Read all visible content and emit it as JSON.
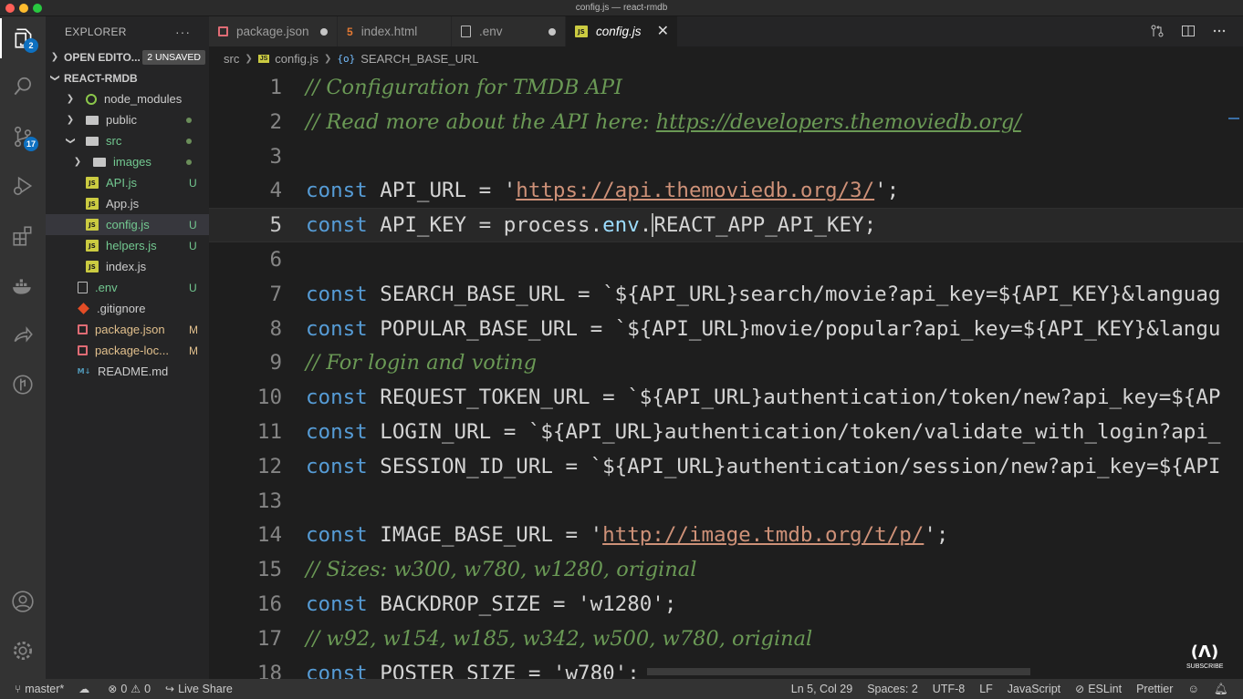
{
  "window": {
    "title": "config.js — react-rmdb"
  },
  "activity": {
    "explorer_badge": "2",
    "scm_badge": "17"
  },
  "sidebar": {
    "header": "EXPLORER",
    "more": "···",
    "open_editors": {
      "label": "OPEN EDITO...",
      "badge": "2 UNSAVED"
    },
    "project": "REACT-RMDB",
    "tree": [
      {
        "name": "node_modules",
        "status": ""
      },
      {
        "name": "public",
        "status": ""
      },
      {
        "name": "src",
        "status": ""
      },
      {
        "name": "images",
        "status": ""
      },
      {
        "name": "API.js",
        "status": "U"
      },
      {
        "name": "App.js",
        "status": ""
      },
      {
        "name": "config.js",
        "status": "U"
      },
      {
        "name": "helpers.js",
        "status": "U"
      },
      {
        "name": "index.js",
        "status": ""
      },
      {
        "name": ".env",
        "status": "U"
      },
      {
        "name": ".gitignore",
        "status": ""
      },
      {
        "name": "package.json",
        "status": "M"
      },
      {
        "name": "package-loc...",
        "status": "M"
      },
      {
        "name": "README.md",
        "status": ""
      }
    ]
  },
  "tabs": [
    {
      "label": "package.json",
      "icon": "json-icon"
    },
    {
      "label": "index.html",
      "icon": "html-icon"
    },
    {
      "label": ".env",
      "icon": "env-file-icon"
    },
    {
      "label": "config.js",
      "icon": "js-icon"
    }
  ],
  "breadcrumb": {
    "folder": "src",
    "file": "config.js",
    "symbol": "SEARCH_BASE_URL",
    "js_badge": "JS",
    "symbol_icon": "{o}"
  },
  "editor": {
    "lines": [
      [
        [
          "com",
          "// Configuration for TMDB API"
        ]
      ],
      [
        [
          "com",
          "// Read more about the API here: "
        ],
        [
          "comurl",
          "https://developers.themoviedb.org/"
        ]
      ],
      [],
      [
        [
          "kw",
          "const "
        ],
        [
          "plain",
          "API_URL = '"
        ],
        [
          "url",
          "https://api.themoviedb.org/3/"
        ],
        [
          "plain",
          "';"
        ]
      ],
      [
        [
          "kw",
          "const "
        ],
        [
          "plain",
          "API_KEY = process."
        ],
        [
          "id",
          "env"
        ],
        [
          "plain",
          "."
        ],
        [
          "cursor",
          ""
        ],
        [
          "plain",
          "REACT_APP_API_KEY;"
        ]
      ],
      [],
      [
        [
          "kw",
          "const "
        ],
        [
          "plain",
          "SEARCH_BASE_URL = `${API_URL}search/movie?api_key=${API_KEY}&languag"
        ]
      ],
      [
        [
          "kw",
          "const "
        ],
        [
          "plain",
          "POPULAR_BASE_URL = `${API_URL}movie/popular?api_key=${API_KEY}&langu"
        ]
      ],
      [
        [
          "com",
          "// For login and voting"
        ]
      ],
      [
        [
          "kw",
          "const "
        ],
        [
          "plain",
          "REQUEST_TOKEN_URL = `${API_URL}authentication/token/new?api_key=${AP"
        ]
      ],
      [
        [
          "kw",
          "const "
        ],
        [
          "plain",
          "LOGIN_URL = `${API_URL}authentication/token/validate_with_login?api_"
        ]
      ],
      [
        [
          "kw",
          "const "
        ],
        [
          "plain",
          "SESSION_ID_URL = `${API_URL}authentication/session/new?api_key=${API"
        ]
      ],
      [],
      [
        [
          "kw",
          "const "
        ],
        [
          "plain",
          "IMAGE_BASE_URL = '"
        ],
        [
          "url",
          "http://image.tmdb.org/t/p/"
        ],
        [
          "plain",
          "';"
        ]
      ],
      [
        [
          "com",
          "// Sizes: w300, w780, w1280, original"
        ]
      ],
      [
        [
          "kw",
          "const "
        ],
        [
          "plain",
          "BACKDROP_SIZE = 'w1280';"
        ]
      ],
      [
        [
          "com",
          "// w92, w154, w185, w342, w500, w780, original"
        ]
      ],
      [
        [
          "kw",
          "const "
        ],
        [
          "plain",
          "POSTER SIZE = 'w780':"
        ]
      ]
    ],
    "current_line": 5
  },
  "watermark": {
    "glyph": "(🔥)",
    "label": "SUBSCRIBE"
  },
  "statusbar": {
    "branch": "master*",
    "errors": "0",
    "warnings": "0",
    "live_share": "Live Share",
    "position": "Ln 5, Col 29",
    "spaces": "Spaces: 2",
    "encoding": "UTF-8",
    "eol": "LF",
    "language": "JavaScript",
    "eslint": "ESLint",
    "prettier": "Prettier"
  }
}
